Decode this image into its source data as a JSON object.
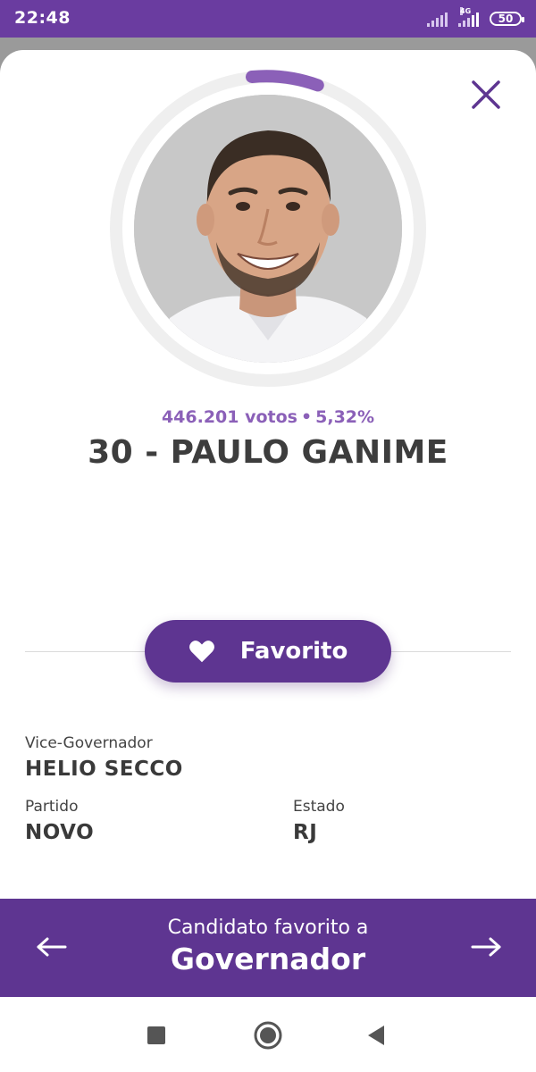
{
  "status_bar": {
    "time": "22:48",
    "network_label": "4G",
    "battery": "50",
    "bar_color": "#6a3ca0"
  },
  "candidate": {
    "votes_text": "446.201 votos",
    "separator": "•",
    "percent_text": "5,32%",
    "vote_share": 0.0532,
    "title": "30 - PAULO GANIME",
    "photo_icon": "candidate-photo"
  },
  "favorite_button": {
    "label": "Favorito",
    "icon": "heart-icon"
  },
  "details": {
    "vice_label": "Vice-Governador",
    "vice_value": "HELIO SECCO",
    "party_label": "Partido",
    "party_value": "NOVO",
    "state_label": "Estado",
    "state_value": "RJ"
  },
  "banner": {
    "line1": "Candidato favorito a",
    "line2": "Governador",
    "left_icon": "arrow-left-icon",
    "right_icon": "arrow-right-icon"
  },
  "nav": {
    "recents_icon": "square-icon",
    "home_icon": "circle-icon",
    "back_icon": "triangle-back-icon"
  },
  "colors": {
    "accent": "#5e3591",
    "accent_light": "#8b60b8",
    "text_dark": "#3d3d3d"
  }
}
